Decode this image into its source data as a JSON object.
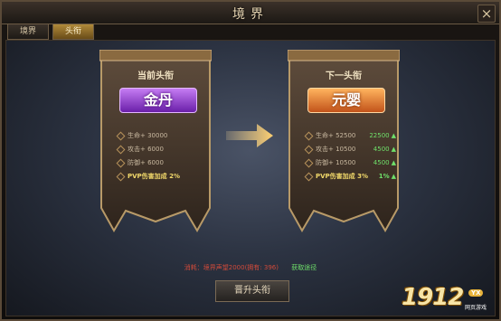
{
  "window": {
    "title": "境界",
    "close_glyph": "×"
  },
  "tabs": [
    {
      "label": "境界",
      "active": false
    },
    {
      "label": "头衔",
      "active": true
    }
  ],
  "current": {
    "header": "当前头衔",
    "rank": "金丹",
    "stats": [
      {
        "label": "生命+ 30000"
      },
      {
        "label": "攻击+ 6000"
      },
      {
        "label": "防御+ 6000"
      }
    ],
    "pvp": "PVP伤害加成  2%"
  },
  "next": {
    "header": "下一头衔",
    "rank": "元婴",
    "stats": [
      {
        "label": "生命+ 52500",
        "increase": "22500"
      },
      {
        "label": "攻击+ 10500",
        "increase": "4500"
      },
      {
        "label": "防御+ 10500",
        "increase": "4500"
      }
    ],
    "pvp": "PVP伤害加成  3%",
    "pvp_increase": "1%"
  },
  "requirement": {
    "text": "消耗：境界声望2000(拥有: 396)",
    "get_link": "获取途径"
  },
  "promote_button": "晋升头衔",
  "watermark": {
    "num": "1912",
    "badge": "YX",
    "sub": "网页游戏"
  },
  "colors": {
    "purple": "#8a3ad0",
    "orange": "#e07a2a",
    "gain": "#6fe06a",
    "warn": "#d04a3a"
  }
}
